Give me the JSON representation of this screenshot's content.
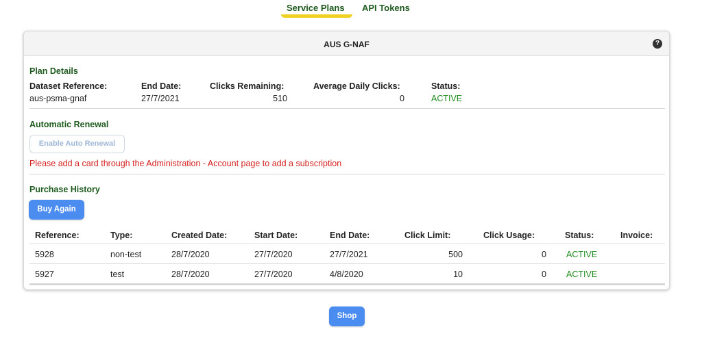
{
  "tabs": [
    {
      "label": "Service Plans",
      "active": true
    },
    {
      "label": "API Tokens",
      "active": false
    }
  ],
  "card": {
    "title": "AUS G-NAF",
    "help_icon": "question-circle-icon"
  },
  "plan_details": {
    "title": "Plan Details",
    "fields": {
      "dataset_reference": {
        "label": "Dataset Reference:",
        "value": "aus-psma-gnaf"
      },
      "end_date": {
        "label": "End Date:",
        "value": "27/7/2021"
      },
      "clicks_remaining": {
        "label": "Clicks Remaining:",
        "value": "510"
      },
      "average_daily_clicks": {
        "label": "Average Daily Clicks:",
        "value": "0"
      },
      "status": {
        "label": "Status:",
        "value": "ACTIVE"
      }
    }
  },
  "automatic_renewal": {
    "title": "Automatic Renewal",
    "button_label": "Enable Auto Renewal",
    "warning": "Please add a card through the Administration - Account page to add a subscription"
  },
  "purchase_history": {
    "title": "Purchase History",
    "buy_again_label": "Buy Again",
    "columns": [
      "Reference:",
      "Type:",
      "Created Date:",
      "Start Date:",
      "End Date:",
      "Click Limit:",
      "Click Usage:",
      "Status:",
      "Invoice:"
    ],
    "rows": [
      [
        "5928",
        "non-test",
        "28/7/2020",
        "27/7/2020",
        "27/7/2021",
        "500",
        "0",
        "ACTIVE",
        ""
      ],
      [
        "5927",
        "test",
        "28/7/2020",
        "27/7/2020",
        "4/8/2020",
        "10",
        "0",
        "ACTIVE",
        ""
      ]
    ]
  },
  "shop_label": "Shop",
  "colors": {
    "accent_underline": "#f0d226",
    "section_green": "#1f5a1f",
    "active_green": "#1e8c1e",
    "primary_button": "#4a8cf0",
    "warning_red": "#d52020"
  }
}
